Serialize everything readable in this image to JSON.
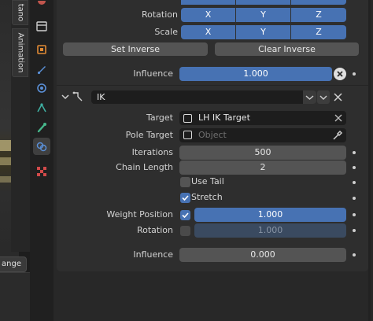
{
  "left_tabs": {
    "top_label": "tano",
    "animation_label": "Animation"
  },
  "viewport": {
    "button_label": "ange"
  },
  "colors": {
    "accent": "#4772b3",
    "panel": "#2e2e2e",
    "field": "#545454"
  },
  "icons": [
    "object-icon",
    "modifier-icon",
    "particles-icon",
    "physics-icon",
    "constraints-icon",
    "object-data-icon",
    "bone-constraint-icon",
    "texture-icon"
  ],
  "top_constraint": {
    "rotation": {
      "label": "Rotation",
      "x": "X",
      "y": "Y",
      "z": "Z"
    },
    "scale": {
      "label": "Scale",
      "x": "X",
      "y": "Y",
      "z": "Z"
    },
    "set_inverse": "Set Inverse",
    "clear_inverse": "Clear Inverse",
    "influence": {
      "label": "Influence",
      "value": "1.000"
    }
  },
  "ik_constraint": {
    "name": "IK",
    "target": {
      "label": "Target",
      "value": "LH IK Target"
    },
    "pole_target": {
      "label": "Pole Target",
      "placeholder": "Object"
    },
    "iterations": {
      "label": "Iterations",
      "value": "500"
    },
    "chain_length": {
      "label": "Chain Length",
      "value": "2"
    },
    "use_tail": {
      "label": "Use Tail",
      "checked": false
    },
    "stretch": {
      "label": "Stretch",
      "checked": true
    },
    "weight_position": {
      "label": "Weight Position",
      "checked": true,
      "value": "1.000"
    },
    "rotation": {
      "label": "Rotation",
      "checked": false,
      "value": "1.000"
    },
    "influence": {
      "label": "Influence",
      "value": "0.000"
    }
  }
}
